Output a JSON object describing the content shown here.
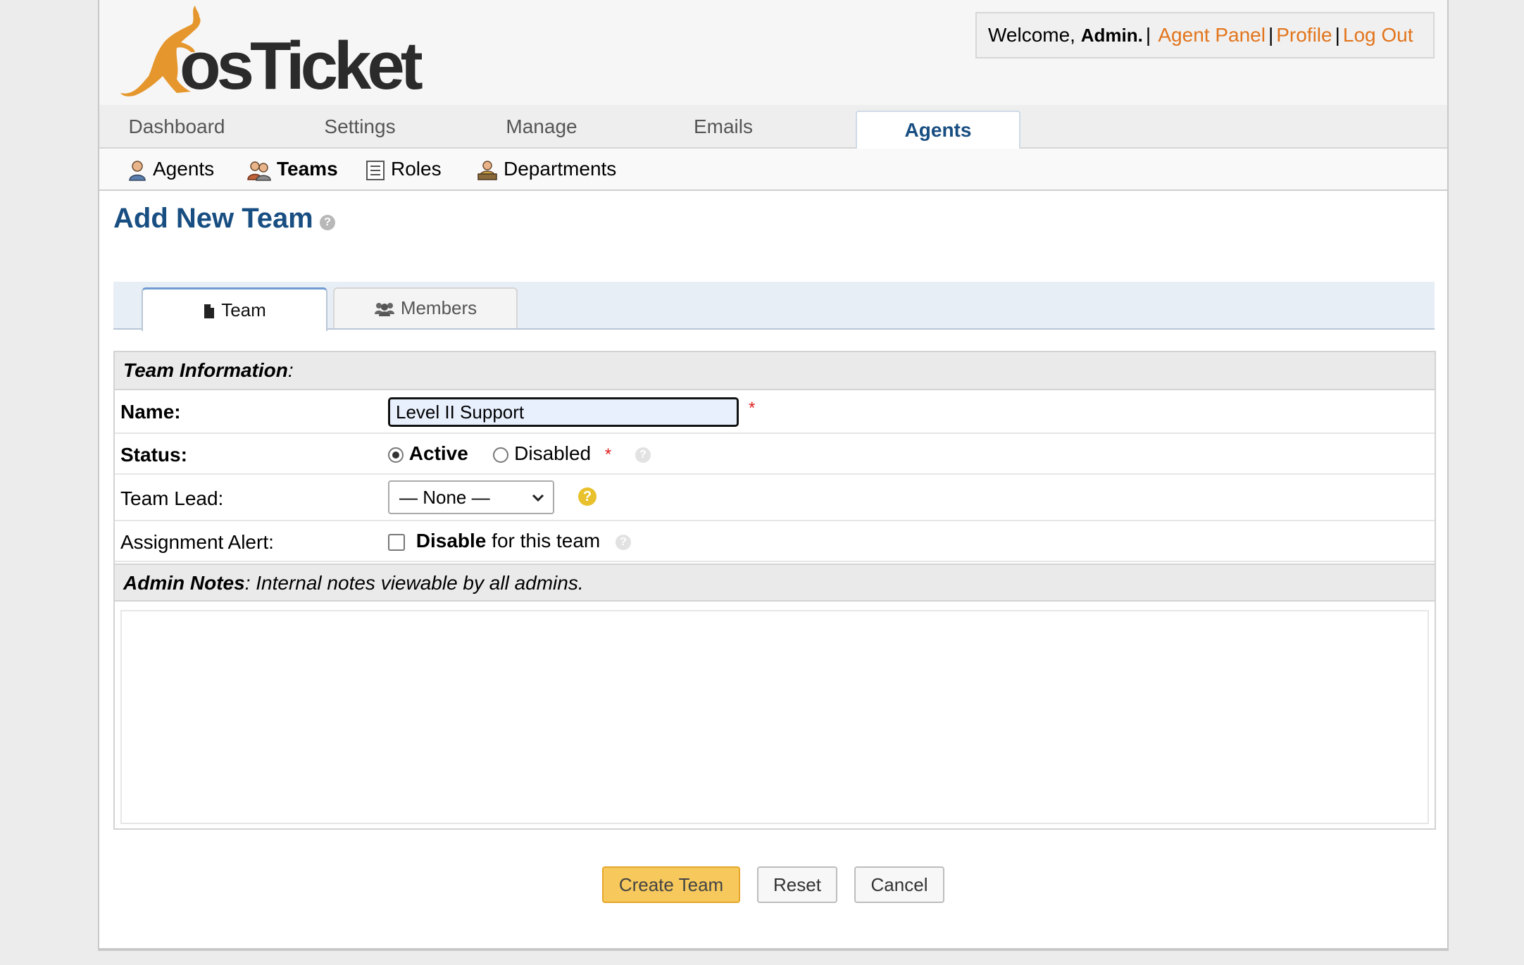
{
  "header": {
    "logo_text": "osTicket",
    "welcome": "Welcome,",
    "user": "Admin.",
    "links": [
      "Agent Panel",
      "Profile",
      "Log Out"
    ]
  },
  "nav": {
    "items": [
      "Dashboard",
      "Settings",
      "Manage",
      "Emails",
      "Agents"
    ],
    "active": "Agents"
  },
  "subnav": {
    "items": [
      "Agents",
      "Teams",
      "Roles",
      "Departments"
    ],
    "active": "Teams"
  },
  "page": {
    "title": "Add New Team"
  },
  "tabs": [
    "Team",
    "Members"
  ],
  "form": {
    "section_title": "Team Information",
    "section_suffix": ":",
    "name_label": "Name:",
    "name_value": "Level II Support",
    "required_mark": "*",
    "status_label": "Status:",
    "status_options": [
      "Active",
      "Disabled"
    ],
    "status_selected": "Active",
    "lead_label": "Team Lead:",
    "lead_value": "— None —",
    "alert_label": "Assignment Alert:",
    "alert_bold": "Disable",
    "alert_rest": "for this team",
    "alert_checked": false,
    "notes_title": "Admin Notes",
    "notes_hint": ": Internal notes viewable by all admins.",
    "notes_value": ""
  },
  "buttons": {
    "create": "Create Team",
    "reset": "Reset",
    "cancel": "Cancel"
  },
  "colors": {
    "brand_orange": "#e2741b",
    "title_blue": "#184e81",
    "primary_button": "#f7c95c"
  }
}
